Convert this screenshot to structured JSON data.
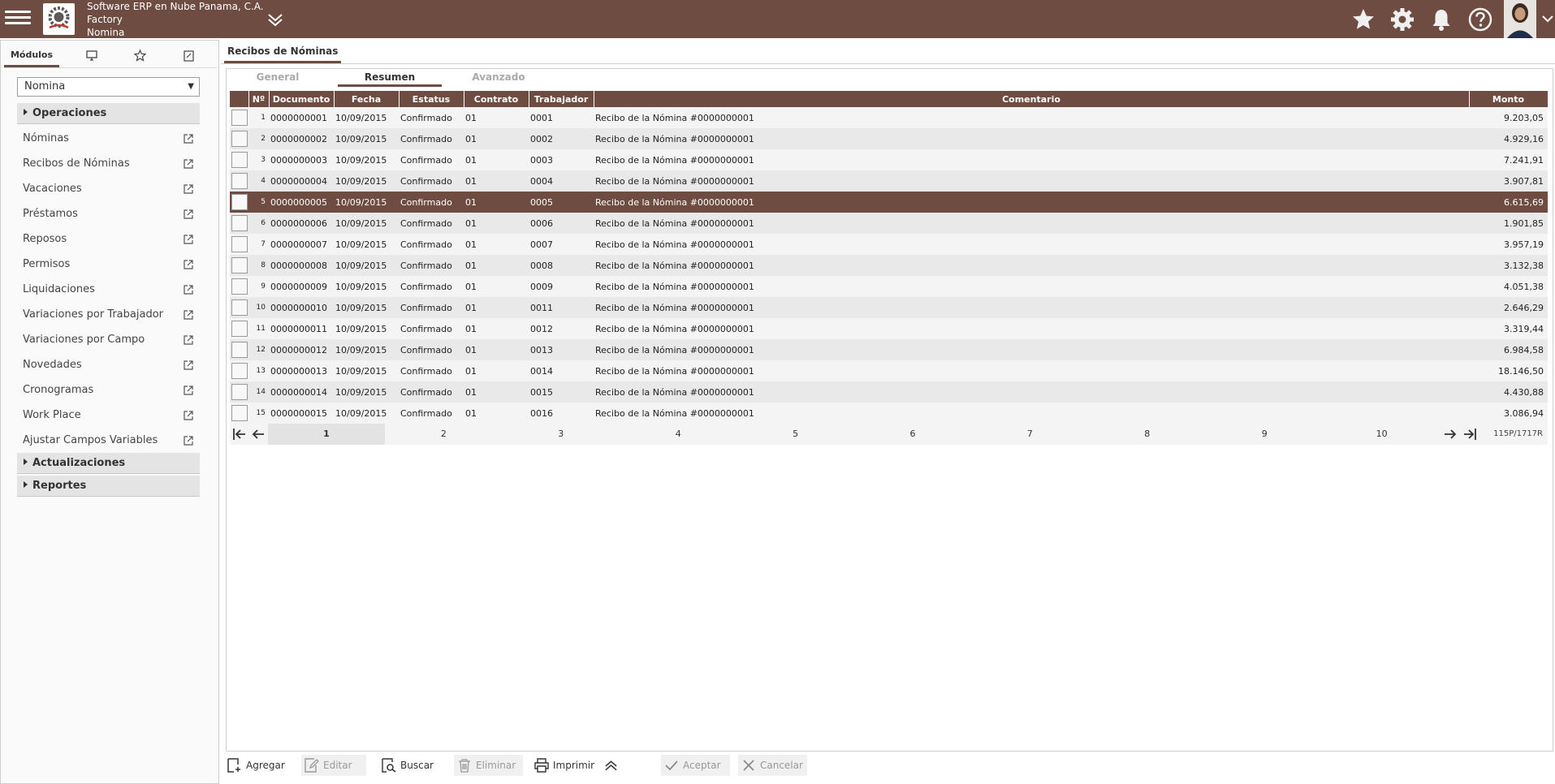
{
  "header": {
    "company_name": "Software ERP en Nube Panama, C.A.",
    "company_type": "Factory",
    "module": "Nomina"
  },
  "left_panel": {
    "tabs": [
      {
        "label": "Módulos",
        "icon": "",
        "active": true
      },
      {
        "label": "",
        "icon": "desktop-icon"
      },
      {
        "label": "",
        "icon": "star-icon"
      },
      {
        "label": "",
        "icon": "notes-icon"
      }
    ],
    "module_select": {
      "value": "Nomina"
    },
    "sections": {
      "operaciones": "Operaciones",
      "actualizaciones": "Actualizaciones",
      "reportes": "Reportes"
    },
    "menu_items": [
      "Nóminas",
      "Recibos de Nóminas",
      "Vacaciones",
      "Préstamos",
      "Reposos",
      "Permisos",
      "Liquidaciones",
      "Variaciones por Trabajador",
      "Variaciones por Campo",
      "Novedades",
      "Cronogramas",
      "Work Place",
      "Ajustar Campos Variables"
    ]
  },
  "main": {
    "tab_title": "Recibos de Nóminas",
    "subtabs": [
      "General",
      "Resumen",
      "Avanzado"
    ],
    "active_subtab": "Resumen",
    "columns": [
      "",
      "Nº",
      "Documento",
      "Fecha",
      "Estatus",
      "Contrato",
      "Trabajador",
      "Comentario",
      "Monto"
    ],
    "rows": [
      {
        "n": "1",
        "documento": "0000000001",
        "fecha": "10/09/2015",
        "estatus": "Confirmado",
        "contrato": "01",
        "trabajador": "0001",
        "comentario": "Recibo de la Nómina #0000000001",
        "monto": "9.203,05"
      },
      {
        "n": "2",
        "documento": "0000000002",
        "fecha": "10/09/2015",
        "estatus": "Confirmado",
        "contrato": "01",
        "trabajador": "0002",
        "comentario": "Recibo de la Nómina #0000000001",
        "monto": "4.929,16"
      },
      {
        "n": "3",
        "documento": "0000000003",
        "fecha": "10/09/2015",
        "estatus": "Confirmado",
        "contrato": "01",
        "trabajador": "0003",
        "comentario": "Recibo de la Nómina #0000000001",
        "monto": "7.241,91"
      },
      {
        "n": "4",
        "documento": "0000000004",
        "fecha": "10/09/2015",
        "estatus": "Confirmado",
        "contrato": "01",
        "trabajador": "0004",
        "comentario": "Recibo de la Nómina #0000000001",
        "monto": "3.907,81"
      },
      {
        "n": "5",
        "documento": "0000000005",
        "fecha": "10/09/2015",
        "estatus": "Confirmado",
        "contrato": "01",
        "trabajador": "0005",
        "comentario": "Recibo de la Nómina #0000000001",
        "monto": "6.615,69",
        "selected": true
      },
      {
        "n": "6",
        "documento": "0000000006",
        "fecha": "10/09/2015",
        "estatus": "Confirmado",
        "contrato": "01",
        "trabajador": "0006",
        "comentario": "Recibo de la Nómina #0000000001",
        "monto": "1.901,85"
      },
      {
        "n": "7",
        "documento": "0000000007",
        "fecha": "10/09/2015",
        "estatus": "Confirmado",
        "contrato": "01",
        "trabajador": "0007",
        "comentario": "Recibo de la Nómina #0000000001",
        "monto": "3.957,19"
      },
      {
        "n": "8",
        "documento": "0000000008",
        "fecha": "10/09/2015",
        "estatus": "Confirmado",
        "contrato": "01",
        "trabajador": "0008",
        "comentario": "Recibo de la Nómina #0000000001",
        "monto": "3.132,38"
      },
      {
        "n": "9",
        "documento": "0000000009",
        "fecha": "10/09/2015",
        "estatus": "Confirmado",
        "contrato": "01",
        "trabajador": "0009",
        "comentario": "Recibo de la Nómina #0000000001",
        "monto": "4.051,38"
      },
      {
        "n": "10",
        "documento": "0000000010",
        "fecha": "10/09/2015",
        "estatus": "Confirmado",
        "contrato": "01",
        "trabajador": "0011",
        "comentario": "Recibo de la Nómina #0000000001",
        "monto": "2.646,29"
      },
      {
        "n": "11",
        "documento": "0000000011",
        "fecha": "10/09/2015",
        "estatus": "Confirmado",
        "contrato": "01",
        "trabajador": "0012",
        "comentario": "Recibo de la Nómina #0000000001",
        "monto": "3.319,44"
      },
      {
        "n": "12",
        "documento": "0000000012",
        "fecha": "10/09/2015",
        "estatus": "Confirmado",
        "contrato": "01",
        "trabajador": "0013",
        "comentario": "Recibo de la Nómina #0000000001",
        "monto": "6.984,58"
      },
      {
        "n": "13",
        "documento": "0000000013",
        "fecha": "10/09/2015",
        "estatus": "Confirmado",
        "contrato": "01",
        "trabajador": "0014",
        "comentario": "Recibo de la Nómina #0000000001",
        "monto": "18.146,50"
      },
      {
        "n": "14",
        "documento": "0000000014",
        "fecha": "10/09/2015",
        "estatus": "Confirmado",
        "contrato": "01",
        "trabajador": "0015",
        "comentario": "Recibo de la Nómina #0000000001",
        "monto": "4.430,88"
      },
      {
        "n": "15",
        "documento": "0000000015",
        "fecha": "10/09/2015",
        "estatus": "Confirmado",
        "contrato": "01",
        "trabajador": "0016",
        "comentario": "Recibo de la Nómina #0000000001",
        "monto": "3.086,94"
      }
    ],
    "pager": {
      "pages": [
        "1",
        "2",
        "3",
        "4",
        "5",
        "6",
        "7",
        "8",
        "9",
        "10"
      ],
      "current": "1",
      "info": "115P/1717R"
    }
  },
  "toolbar": {
    "agregar": "Agregar",
    "editar": "Editar",
    "buscar": "Buscar",
    "eliminar": "Eliminar",
    "imprimir": "Imprimir",
    "aceptar": "Aceptar",
    "cancelar": "Cancelar"
  },
  "colors": {
    "brand": "#6f4c42",
    "row_odd": "#f4f4f4",
    "row_even": "#e9e9e9"
  }
}
